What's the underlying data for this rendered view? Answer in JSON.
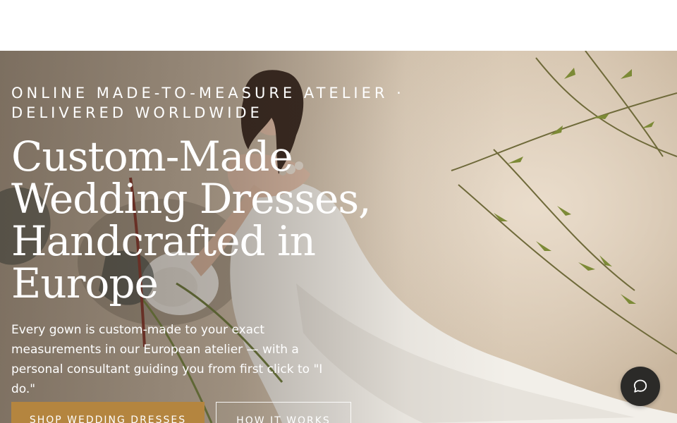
{
  "hero": {
    "eyebrow": "ONLINE MADE-TO-MEASURE ATELIER · DELIVERED WORLDWIDE",
    "headline": "Custom-Made Wedding Dresses, Handcrafted in Europe",
    "subtext": "Every gown is custom-made to your exact measurements in our European atelier — with a personal consultant guiding you from first click to \"I do.\"",
    "primary_cta": "SHOP WEDDING DRESSES",
    "secondary_cta": "HOW IT WORKS"
  },
  "chat": {
    "icon": "chat-bubble-icon"
  },
  "colors": {
    "accent": "#b4853f",
    "chat_button": "#2b2a28",
    "text_on_hero": "#ffffff"
  }
}
